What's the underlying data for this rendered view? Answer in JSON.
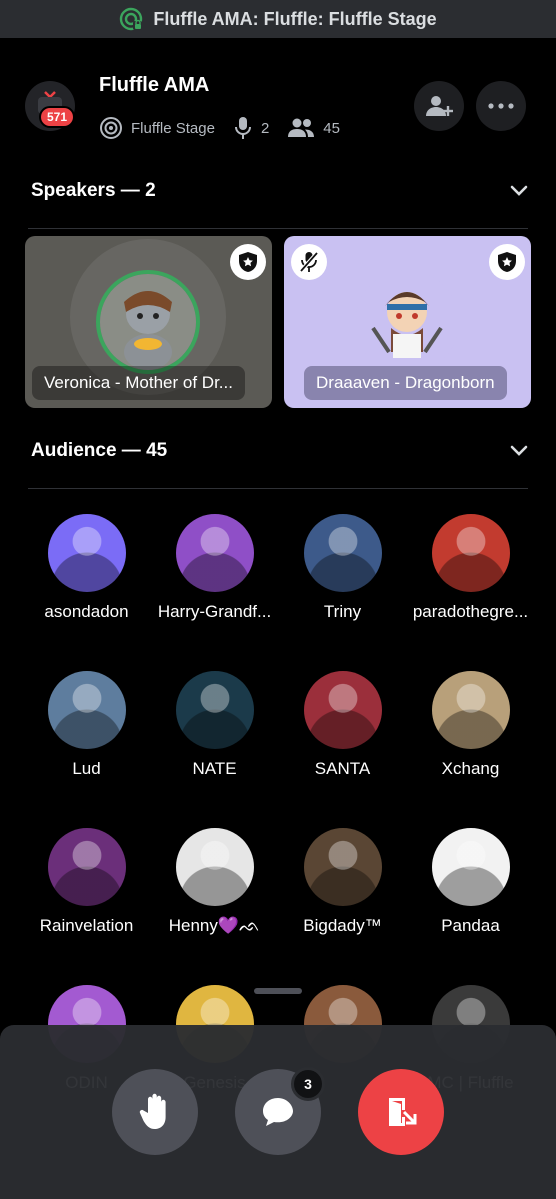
{
  "status_bar": {
    "title": "Fluffle AMA: Fluffle: Fluffle Stage"
  },
  "header": {
    "title": "Fluffle AMA",
    "badge_count": "571",
    "stage_name": "Fluffle Stage",
    "speaker_count": "2",
    "listener_count": "45"
  },
  "speakers": {
    "heading": "Speakers — 2",
    "cards": [
      {
        "name": "Veronica - Mother of Dr...",
        "speaking": true,
        "muted": false
      },
      {
        "name": "Draaaven - Dragonborn",
        "speaking": false,
        "muted": true
      }
    ]
  },
  "audience": {
    "heading": "Audience — 45",
    "members": [
      {
        "name": "asondadon",
        "color": "#7b6cf6"
      },
      {
        "name": "Harry-Grandf...",
        "color": "#8f4fc7"
      },
      {
        "name": "Triny",
        "color": "#3d5a8a"
      },
      {
        "name": "paradothegre...",
        "color": "#c23b2f"
      },
      {
        "name": "Lud",
        "color": "#5e7d9e"
      },
      {
        "name": "NATE",
        "color": "#1b3a4a"
      },
      {
        "name": "SANTA",
        "color": "#9b2f3b"
      },
      {
        "name": "Xchang",
        "color": "#b8a07a"
      },
      {
        "name": "Rainvelation",
        "color": "#6b2f7a"
      },
      {
        "name": "Henny💜ᨒ",
        "color": "#e6e6e6"
      },
      {
        "name": "Bigdady™",
        "color": "#5a4634"
      },
      {
        "name": "Pandaa",
        "color": "#f2f2f2"
      },
      {
        "name": "ODIN",
        "color": "#a35ad1"
      },
      {
        "name": "Genesis",
        "color": "#e0b640"
      },
      {
        "name": "",
        "color": "#8a5a3c"
      },
      {
        "name": "MC | Fluffle",
        "color": "#3a3a3a"
      }
    ]
  },
  "controls": {
    "chat_badge": "3"
  },
  "colors": {
    "leave_red": "#ed4245",
    "speaking_green": "#3ba55d"
  }
}
